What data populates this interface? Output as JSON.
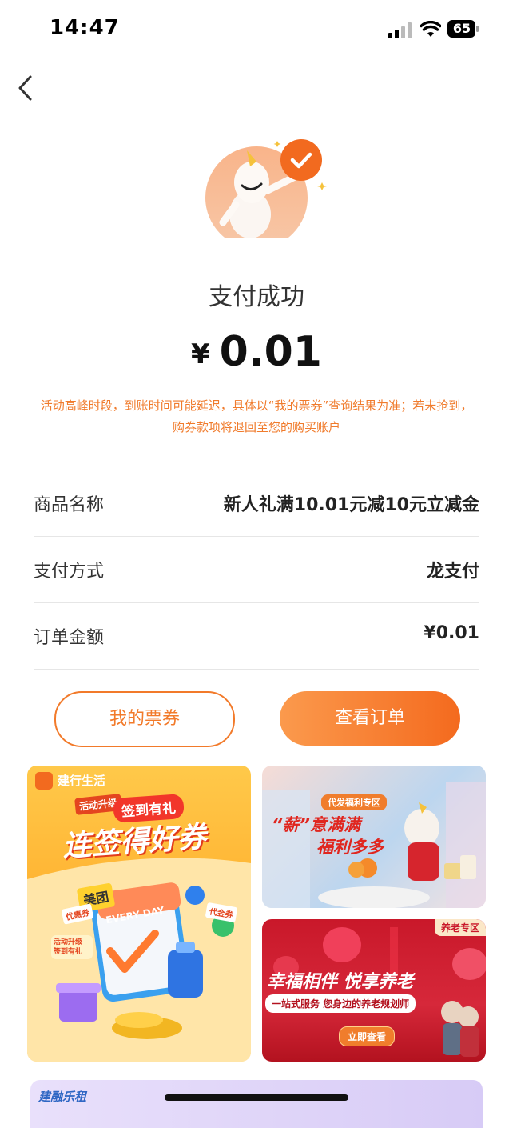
{
  "status_bar": {
    "time": "14:47",
    "battery": "65"
  },
  "header": {
    "back_icon": "chevron-left-icon"
  },
  "result": {
    "title": "支付成功",
    "currency": "¥",
    "amount": "0.01",
    "notice": "活动高峰时段，到账时间可能延迟，具体以“我的票券”查询结果为准；若未抢到，购券款项将退回至您的购买账户"
  },
  "details": [
    {
      "label": "商品名称",
      "value": "新人礼满10.01元减10元立减金"
    },
    {
      "label": "支付方式",
      "value": "龙支付"
    },
    {
      "label": "订单金额",
      "value": "¥0.01"
    }
  ],
  "actions": {
    "my_coupons": "我的票券",
    "view_order": "查看订单"
  },
  "banners": {
    "left": {
      "brand": "建行生活",
      "tag": "活动升级",
      "subtitle": "签到有礼",
      "headline": "连签得好券",
      "meituan": "美团",
      "everyday": "EVERY DAY",
      "coupon1": "优惠券",
      "coupon2": "代金券",
      "sticker": "活动升级 签到有礼"
    },
    "top_right": {
      "tag": "代发福利专区",
      "line1": "“薪”意满满",
      "line2": "福利多多"
    },
    "bottom_right": {
      "tag": "养老专区",
      "headline": "幸福相伴 悦享养老",
      "subline": "一站式服务 您身边的养老规划师",
      "button": "立即查看"
    },
    "bottom": {
      "brand": "建融乐租"
    }
  },
  "colors": {
    "accent": "#f27a2a",
    "notice": "#f07b2c"
  }
}
